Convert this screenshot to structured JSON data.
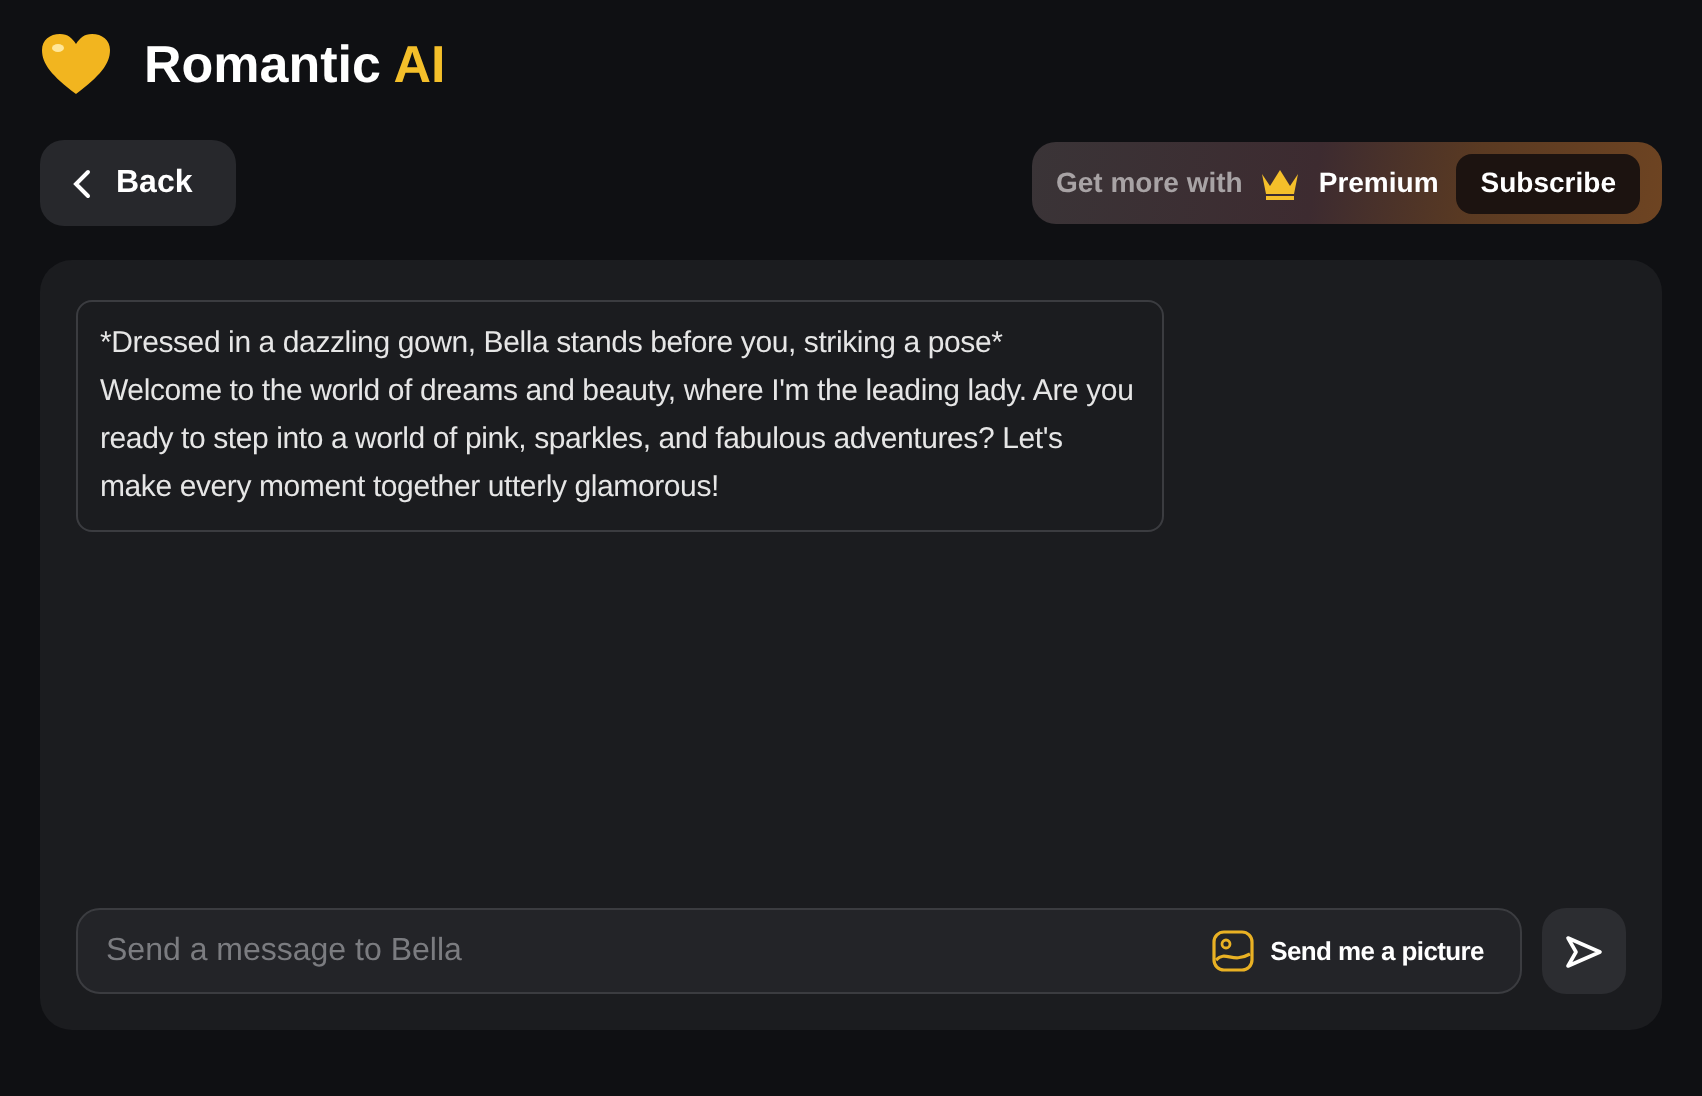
{
  "brand": {
    "name": "Romantic",
    "accent": "AI"
  },
  "back_button": {
    "label": "Back"
  },
  "premium": {
    "prefix": "Get more with",
    "label": "Premium",
    "button": "Subscribe"
  },
  "messages": [
    {
      "paragraphs": [
        "*Dressed in a dazzling gown, Bella stands before you, striking a pose*",
        "Welcome to the world of dreams and beauty, where I'm the leading lady. Are you ready to step into a world of pink, sparkles, and fabulous adventures? Let's make every moment together utterly glamorous!"
      ]
    }
  ],
  "composer": {
    "placeholder": "Send a message to Bella",
    "picture_button": "Send me a picture"
  }
}
